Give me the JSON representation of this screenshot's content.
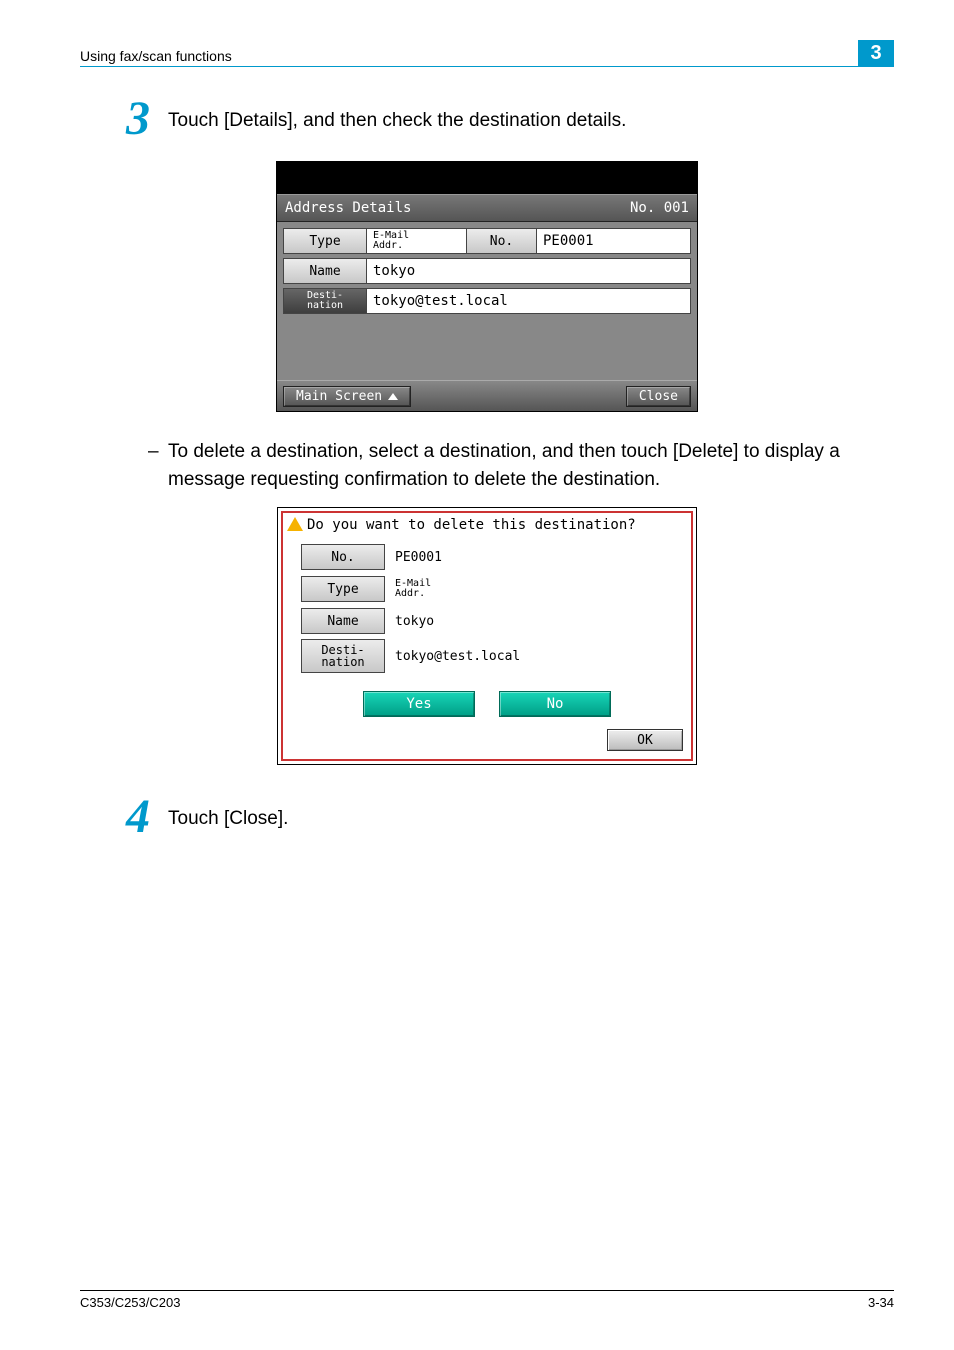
{
  "header": {
    "section_title": "Using fax/scan functions",
    "chapter_number": "3"
  },
  "steps": {
    "s3_number": "3",
    "s3_text": "Touch [Details], and then check the destination details.",
    "bullet_text": "To delete a destination, select a destination, and then touch [Delete] to display a message requesting confirmation to delete the destination.",
    "s4_number": "4",
    "s4_text": "Touch [Close]."
  },
  "panel1": {
    "title_left": "Address Details",
    "title_right": "No. 001",
    "row_type_label": "Type",
    "row_type_value": "E-Mail\nAddr.",
    "row_no_label": "No.",
    "row_no_value": "PE0001",
    "row_name_label": "Name",
    "row_name_value": "tokyo",
    "row_dest_label": "Desti-\nnation",
    "row_dest_value": "tokyo@test.local",
    "main_screen_btn": "Main Screen",
    "close_btn": "Close"
  },
  "panel2": {
    "message": "Do you want to delete this destination?",
    "row_no_label": "No.",
    "row_no_value": "PE0001",
    "row_type_label": "Type",
    "row_type_value": "E-Mail\nAddr.",
    "row_name_label": "Name",
    "row_name_value": "tokyo",
    "row_dest_label": "Desti-\nnation",
    "row_dest_value": "tokyo@test.local",
    "yes_btn": "Yes",
    "no_btn": "No",
    "ok_btn": "OK"
  },
  "footer": {
    "model": "C353/C253/C203",
    "page": "3-34"
  }
}
